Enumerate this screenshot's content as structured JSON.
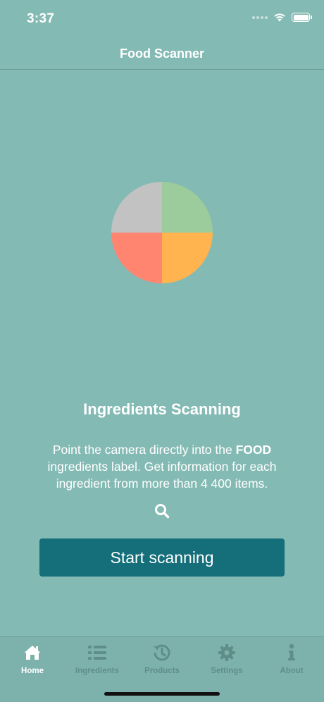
{
  "status_bar": {
    "time": "3:37"
  },
  "nav": {
    "title": "Food Scanner"
  },
  "logo": {
    "quadrant_colors": {
      "top_left": "#c2c2c2",
      "top_right": "#9ccc9b",
      "bottom_left": "#ff8571",
      "bottom_right": "#ffb44f"
    }
  },
  "main": {
    "headline": "Ingredients Scanning",
    "description_before": "Point the camera directly into the ",
    "description_bold": "FOOD",
    "description_after": " ingredients label. Get information for each ingredient from more than 4 400 items.",
    "search_icon": "search-icon",
    "start_button_label": "Start scanning"
  },
  "tab_bar": {
    "tabs": [
      {
        "label": "Home",
        "icon": "home-icon",
        "active": true
      },
      {
        "label": "Ingredients",
        "icon": "list-icon",
        "active": false
      },
      {
        "label": "Products",
        "icon": "history-icon",
        "active": false
      },
      {
        "label": "Settings",
        "icon": "gear-icon",
        "active": false
      },
      {
        "label": "About",
        "icon": "info-icon",
        "active": false
      }
    ]
  },
  "colors": {
    "background": "#84bab4",
    "button": "#146f7b",
    "tab_inactive": "#5f8d88",
    "tab_active": "#ffffff"
  }
}
